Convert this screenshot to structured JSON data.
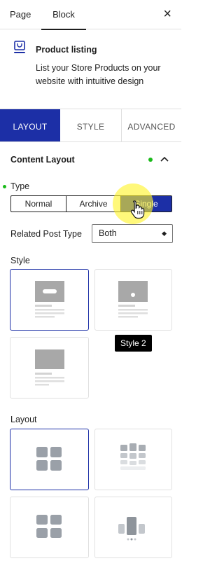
{
  "top_tabs": {
    "page": "Page",
    "block": "Block",
    "close": "×"
  },
  "block": {
    "title": "Product listing",
    "description": "List your Store Products on your website with intuitive design"
  },
  "panel_tabs": {
    "layout": "LAYOUT",
    "style": "STYLE",
    "advanced": "ADVANCED"
  },
  "content_layout": {
    "title": "Content Layout",
    "collapse_icon": "chevron-up",
    "type_label": "Type",
    "type_options": [
      "Normal",
      "Archive",
      "Single"
    ],
    "type_selected": "Single",
    "related_post_type_label": "Related Post Type",
    "related_post_type_value": "Both",
    "style_label": "Style",
    "style_tooltip": "Style 2",
    "layout_label": "Layout"
  },
  "colors": {
    "accent": "#1c2fa6",
    "status_dot": "#1aba1a",
    "highlight": "#fff428"
  }
}
